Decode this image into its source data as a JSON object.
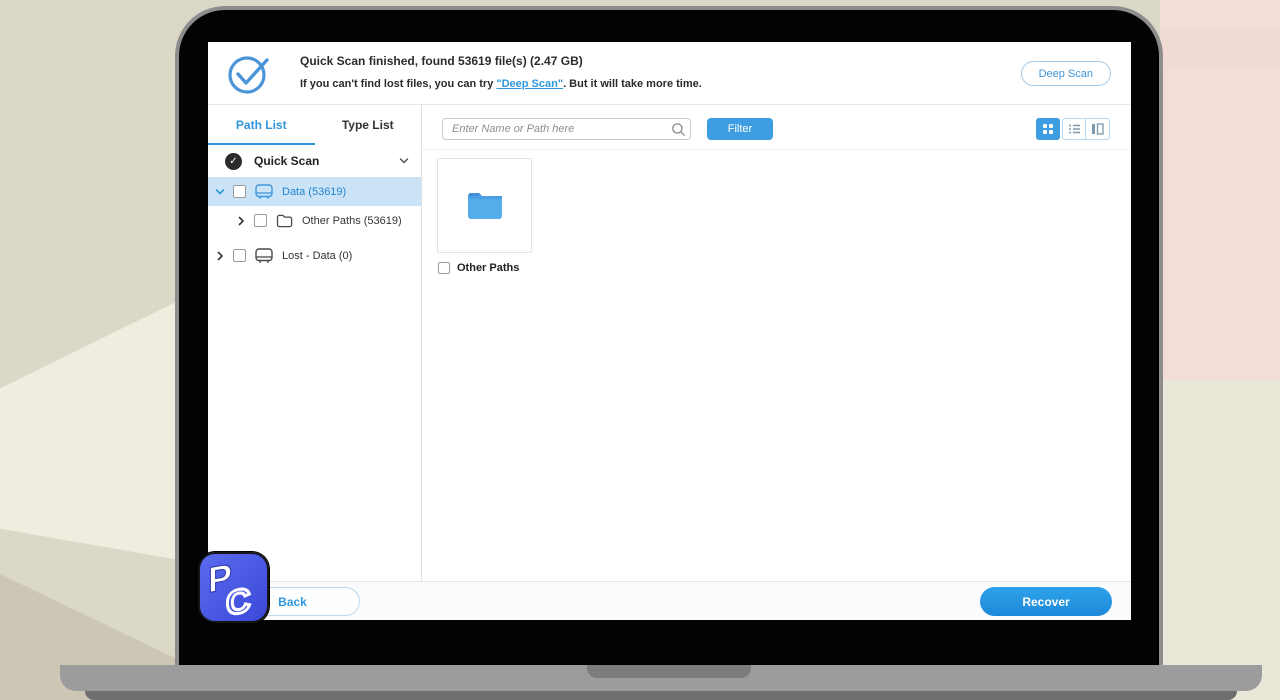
{
  "header": {
    "title": "Quick Scan finished, found 53619 file(s) (2.47 GB)",
    "subtitle_prefix": "If you can't find lost files, you can try ",
    "subtitle_link": "\"Deep Scan\"",
    "subtitle_suffix": ". But it will take more time.",
    "deep_scan_button": "Deep Scan"
  },
  "sidebar": {
    "tabs": [
      {
        "label": "Path List",
        "active": true
      },
      {
        "label": "Type List",
        "active": false
      }
    ],
    "scan_root": {
      "label": "Quick Scan",
      "status": "done",
      "check_glyph": "✓"
    },
    "tree": [
      {
        "label": "Data (53619)",
        "icon": "drive-icon",
        "selected": true,
        "expanded": true,
        "checked": false
      },
      {
        "label": "Other Paths (53619)",
        "icon": "folder-icon",
        "selected": false,
        "expanded": false,
        "checked": false
      },
      {
        "label": "Lost - Data (0)",
        "icon": "drive-icon",
        "selected": false,
        "expanded": false,
        "checked": false
      }
    ]
  },
  "toolbar": {
    "search_placeholder": "Enter Name or Path here",
    "search_value": "",
    "filter_button": "Filter",
    "view_modes": [
      "grid-view",
      "list-view",
      "column-view"
    ],
    "active_view": "grid-view"
  },
  "content": {
    "items": [
      {
        "name": "Other Paths",
        "type": "folder",
        "checked": false
      }
    ]
  },
  "footer": {
    "back_button": "Back",
    "recover_button": "Recover"
  },
  "colors": {
    "accent_blue": "#2f96dd",
    "selected_row": "#cbe3f6",
    "filter_button": "#3d9de0",
    "recover_button": "#2196dd",
    "folder_fill": "#4da6e8"
  },
  "logo": {
    "brand_letters": "PC"
  }
}
